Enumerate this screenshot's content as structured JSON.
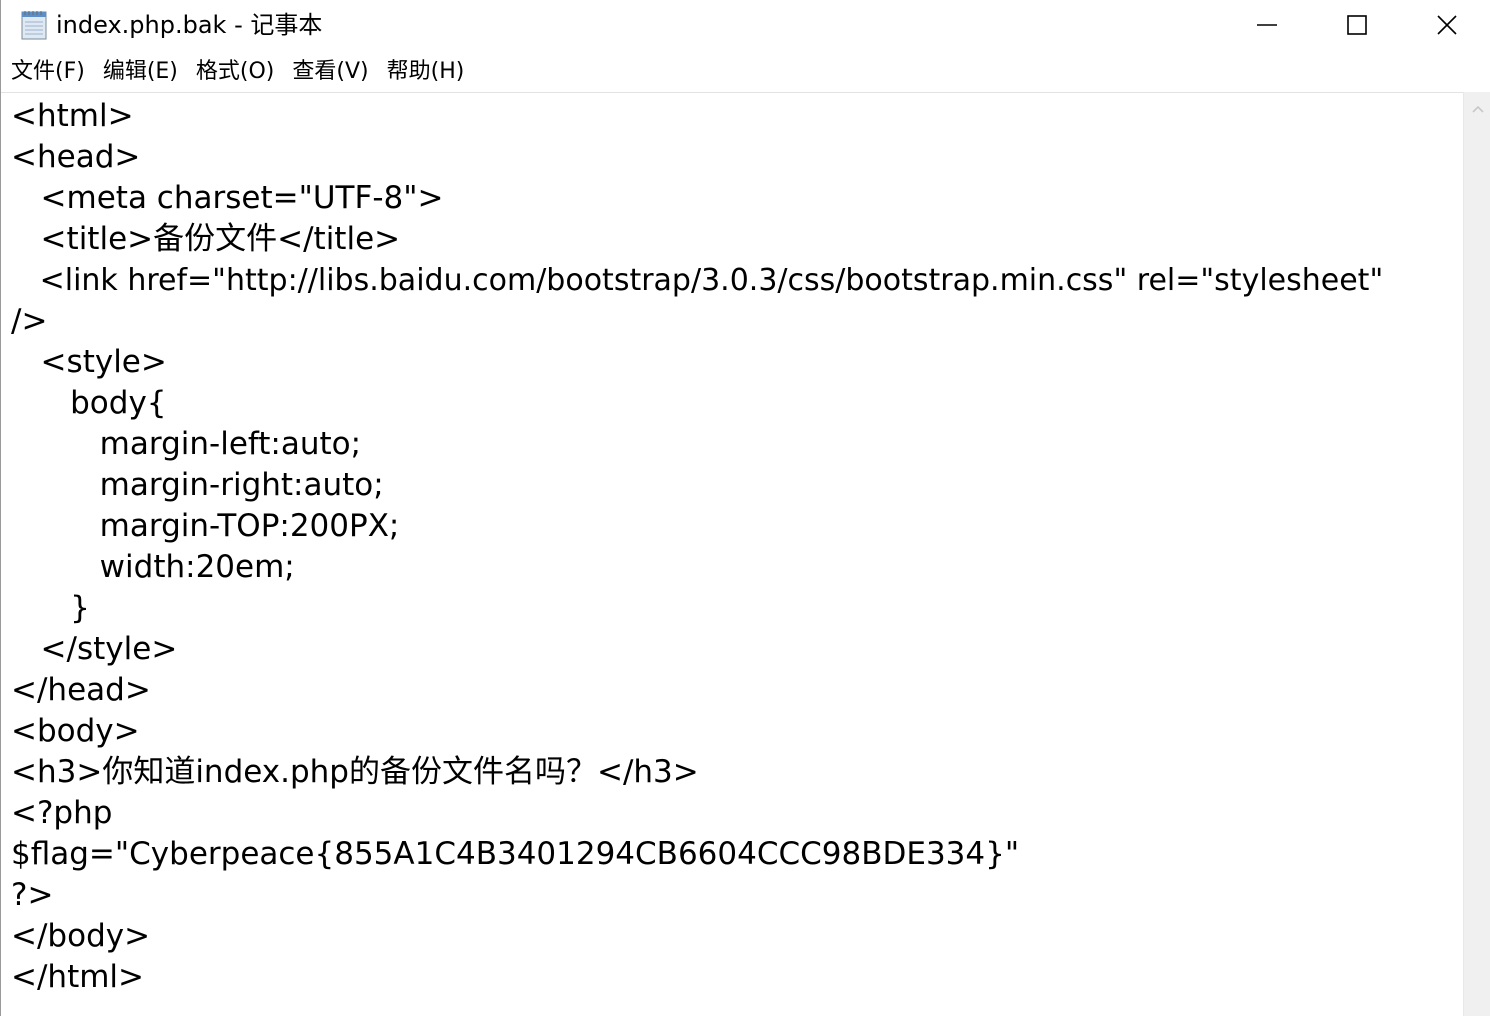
{
  "window": {
    "title": "index.php.bak - 记事本",
    "icon": "notepad-icon",
    "controls": {
      "minimize_icon": "minimize-icon",
      "maximize_icon": "maximize-icon",
      "close_icon": "close-icon"
    }
  },
  "menu": {
    "items": [
      {
        "label": "文件(F)"
      },
      {
        "label": "编辑(E)"
      },
      {
        "label": "格式(O)"
      },
      {
        "label": "查看(V)"
      },
      {
        "label": "帮助(H)"
      }
    ]
  },
  "editor": {
    "lines": [
      "<html>",
      "<head>",
      "   <meta charset=\"UTF-8\">",
      "   <title>备份文件</title>",
      "   <link href=\"http://libs.baidu.com/bootstrap/3.0.3/css/bootstrap.min.css\" rel=\"stylesheet\"",
      "/>",
      "   <style>",
      "      body{",
      "         margin-left:auto;",
      "         margin-right:auto;",
      "         margin-TOP:200PX;",
      "         width:20em;",
      "      }",
      "   </style>",
      "</head>",
      "<body>",
      "<h3>你知道index.php的备份文件名吗？</h3>",
      "<?php",
      "$flag=\"Cyberpeace{855A1C4B3401294CB6604CCC98BDE334}\"",
      "?>",
      "</body>",
      "</html>"
    ]
  },
  "scrollbar": {
    "up_icon": "scroll-up-arrow-icon"
  },
  "colors": {
    "background": "#ffffff",
    "text": "#000000",
    "scrollbar_track": "#f0f0f0"
  }
}
